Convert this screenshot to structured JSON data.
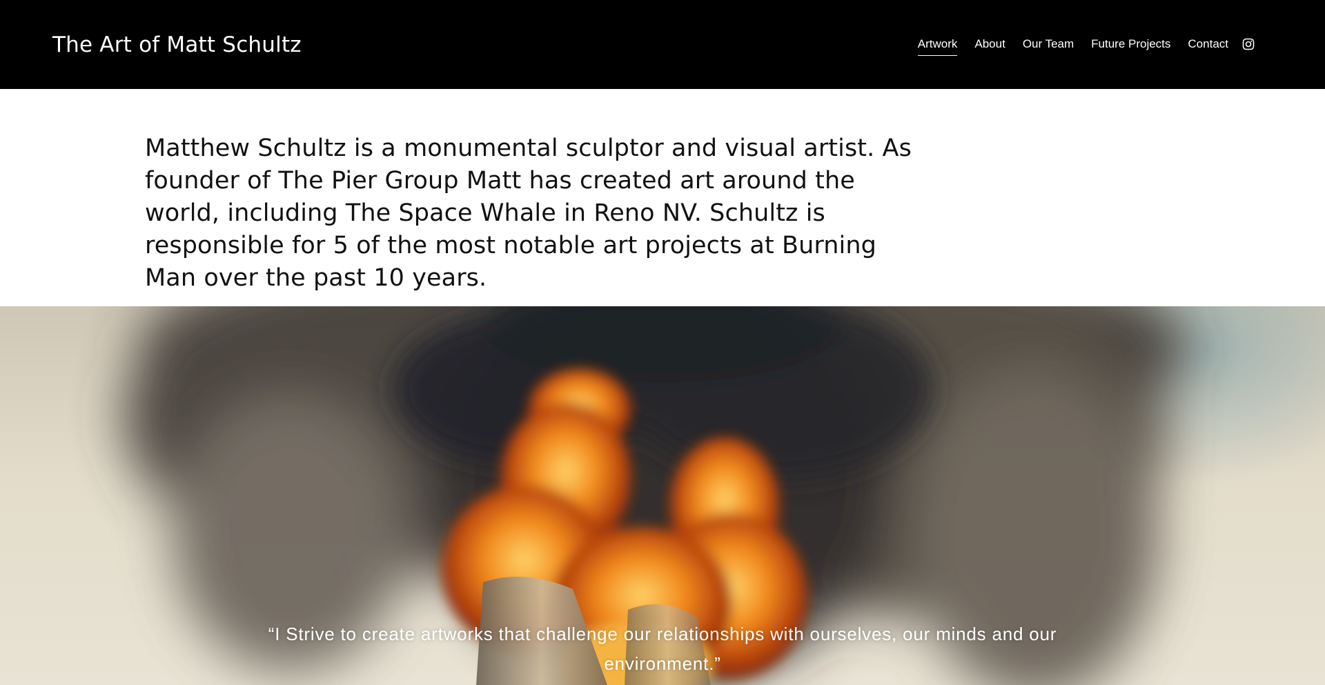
{
  "header": {
    "site_title": "The Art of Matt Schultz",
    "nav": [
      {
        "label": "Artwork",
        "active": true
      },
      {
        "label": "About"
      },
      {
        "label": "Our Team"
      },
      {
        "label": "Future Projects"
      },
      {
        "label": "Contact"
      }
    ],
    "social_icon": "instagram-icon",
    "colors": {
      "background": "#000000",
      "text": "#ffffff"
    }
  },
  "intro": {
    "text": "Matthew Schultz is a monumental sculptor and visual artist. As founder of The Pier Group Matt has created art around the world, including The Space Whale in Reno NV. Schultz is responsible for 5 of the most notable art projects at Burning Man over the past 10 years."
  },
  "hero": {
    "image": "burning-sculpture-with-smoke",
    "quote": "“I Strive to create artworks that challenge our relationships with ourselves, our minds and our environment.”"
  }
}
